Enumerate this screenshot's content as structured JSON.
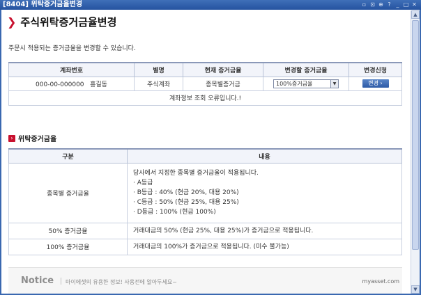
{
  "window": {
    "title": "[8404]  위탁증거금율변경"
  },
  "page": {
    "title": "주식위탁증거금율변경",
    "description": "주문시 적용되는 증거금율을 변경할 수 있습니다."
  },
  "account_table": {
    "headers": [
      "계좌번호",
      "별명",
      "현재 증거금율",
      "변경할 증거금율",
      "변경신청"
    ],
    "row": {
      "account": "000-00-000000   홍길동",
      "nickname": "주식계좌",
      "current_rate": "종목별증거금",
      "new_rate_selected": "100%증거금율",
      "apply_button": "변경 ›"
    },
    "error_message": "계좌정보 조회 오류입니다.!"
  },
  "rate_section": {
    "title": "위탁증거금율",
    "headers": [
      "구분",
      "내용"
    ],
    "rows": [
      {
        "category": "종목별 증거금율",
        "lines": [
          "당사에서 지정한 종목별 증거금율이 적용됩니다.",
          "· A등급",
          "· B등급 : 40% (현금 20%, 대용 20%)",
          "· C등급 : 50% (현금 25%, 대용 25%)",
          "· D등급 : 100% (현금 100%)"
        ]
      },
      {
        "category": "50% 증거금율",
        "lines": [
          "거래대금의 50% (현금 25%, 대용 25%)가 증거금으로 적용됩니다."
        ]
      },
      {
        "category": "100% 증거금율",
        "lines": [
          "거래대금의 100%가 증거금으로 적용됩니다. (미수 불가능)"
        ]
      }
    ]
  },
  "notice": {
    "label": "Notice",
    "message": "마이에셋의 유용한 정보! 사용전에 알아두세요~",
    "brand": "myasset.com"
  },
  "icons": {
    "title_chevron": "chevron-right-icon",
    "section_bullet": "chevron-right-icon",
    "window_controls": [
      "restore-icon",
      "help-icon",
      "minimize-icon",
      "maximize-icon",
      "close-icon"
    ]
  },
  "colors": {
    "titlebar": "#2f5fac",
    "accent": "#c8102e",
    "header_bg": "#f2f4fa",
    "button": "#3a66b0"
  }
}
